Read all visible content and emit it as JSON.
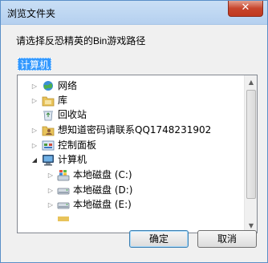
{
  "window": {
    "title": "浏览文件夹",
    "close_glyph": "✕"
  },
  "prompt": "请选择反恐精英的Bin游戏路径",
  "path_value": "计算机",
  "tree": {
    "items": [
      {
        "label": "网络",
        "icon": "network-icon",
        "expanded": false
      },
      {
        "label": "库",
        "icon": "library-folder-icon",
        "expanded": false
      },
      {
        "label": "回收站",
        "icon": "recycle-bin-icon",
        "expanded": false
      },
      {
        "label": "想知道密码请联系QQ1748231902",
        "icon": "user-folder-icon",
        "expanded": false
      },
      {
        "label": "控制面板",
        "icon": "control-panel-icon",
        "expanded": false
      },
      {
        "label": "计算机",
        "icon": "computer-icon",
        "expanded": true
      },
      {
        "label": "本地磁盘 (C:)",
        "icon": "system-drive-icon",
        "expanded": false
      },
      {
        "label": "本地磁盘 (D:)",
        "icon": "hard-drive-icon",
        "expanded": false
      },
      {
        "label": "本地磁盘 (E:)",
        "icon": "hard-drive-icon",
        "expanded": false
      }
    ],
    "scroll_up_glyph": "▲",
    "scroll_down_glyph": "▼",
    "collapsed_glyph": "▷",
    "expanded_glyph": "◢"
  },
  "buttons": {
    "ok": "确定",
    "cancel": "取消"
  }
}
